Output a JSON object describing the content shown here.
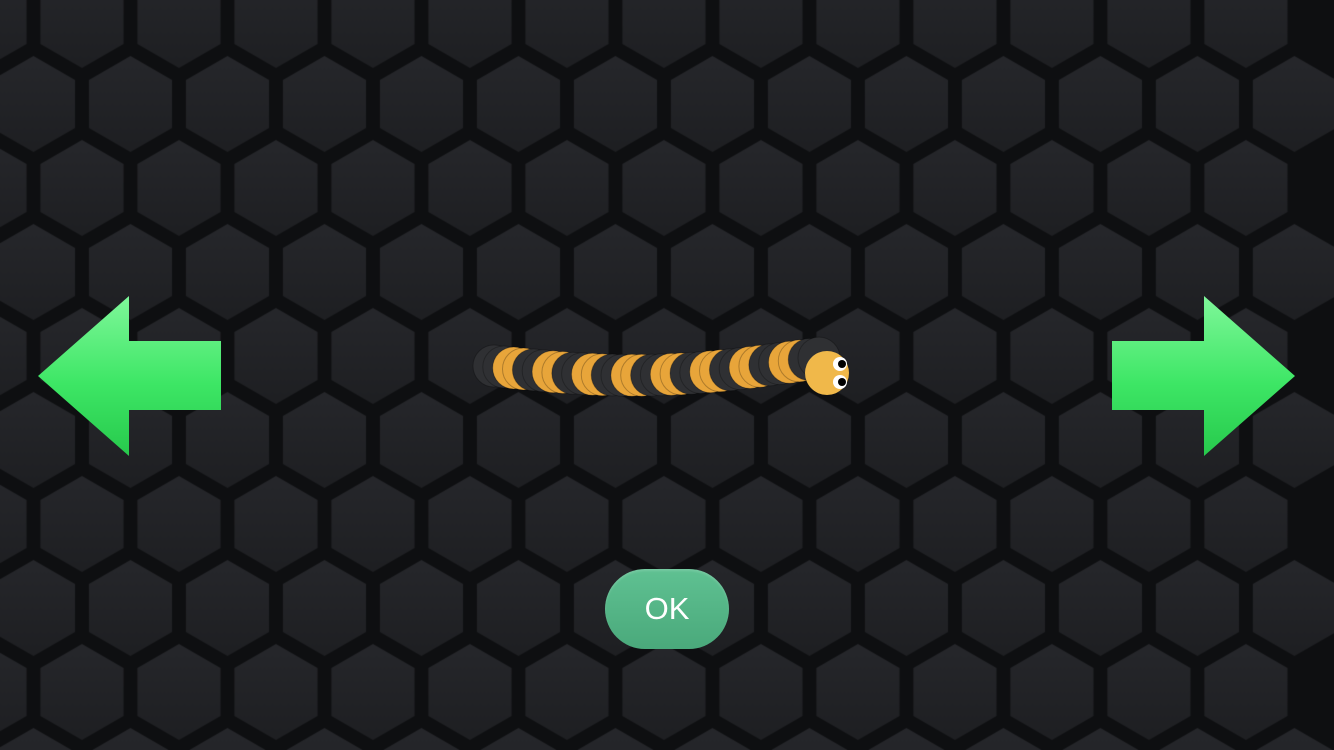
{
  "game": {
    "title": "",
    "background_color": "#0e0f11",
    "hex_tile_color": "#1e1f22",
    "hex_tile_highlight": "#26272b"
  },
  "controls": {
    "previous_skin_icon": "left-arrow-icon",
    "next_skin_icon": "right-arrow-icon",
    "arrow_color": "#35e35e",
    "arrow_highlight": "#8dfaa3",
    "ok_label": "OK",
    "ok_color": "#55b888"
  },
  "snake_skin": {
    "body_color_dark": "#2f3033",
    "body_color_stripe": "#e8a53a",
    "head_color": "#f0b84a",
    "eye_color": "#ffffff",
    "pupil_color": "#000000"
  }
}
